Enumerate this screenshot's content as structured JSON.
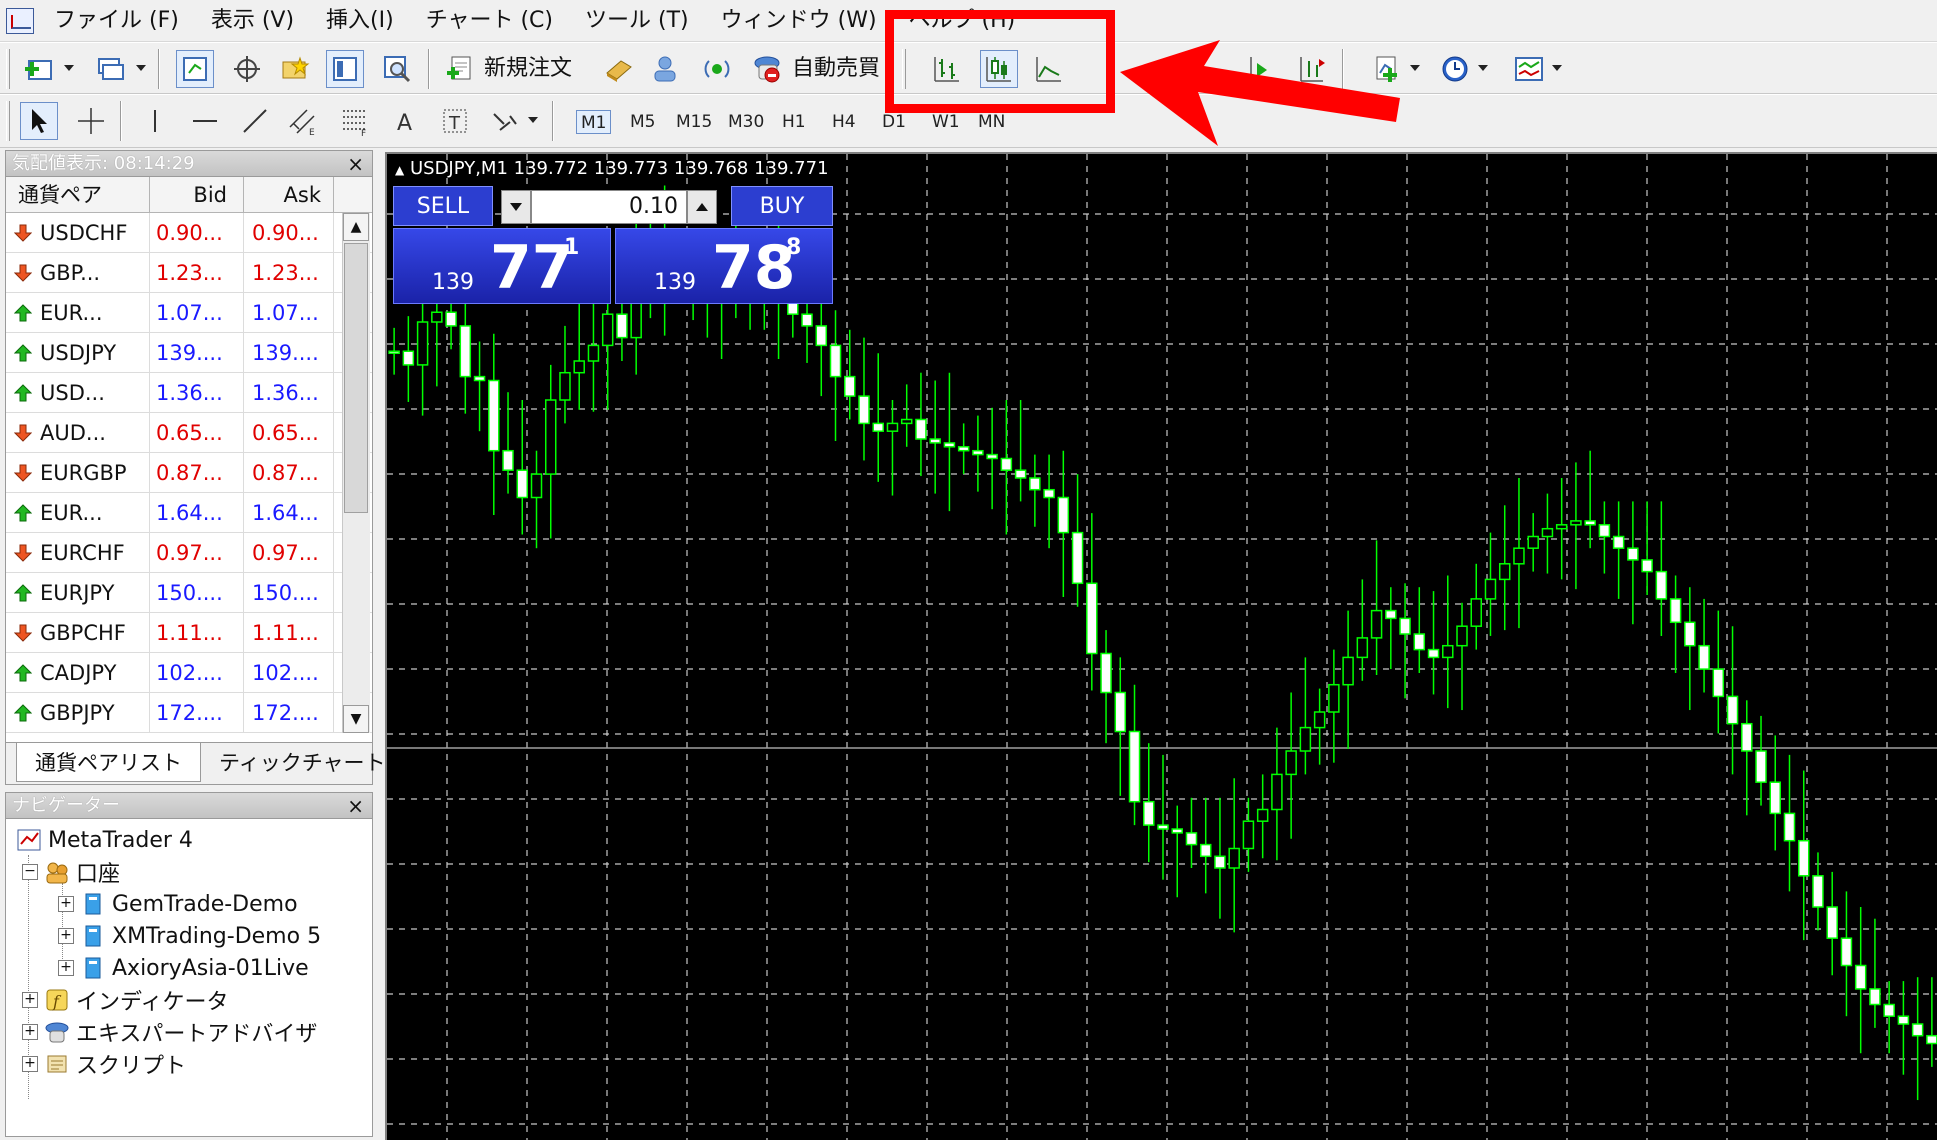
{
  "menu": [
    "ファイル (F)",
    "表示 (V)",
    "挿入(I)",
    "チャート (C)",
    "ツール (T)",
    "ウィンドウ (W)",
    "ヘルプ (H)"
  ],
  "toolbar": {
    "new_order_label": "新規注文",
    "auto_trade_label": "自動売買"
  },
  "timeframes": [
    "M1",
    "M5",
    "M15",
    "M30",
    "H1",
    "H4",
    "D1",
    "W1",
    "MN"
  ],
  "market_watch": {
    "title": "気配値表示: 08:14:29",
    "col_pair": "通貨ペア",
    "col_bid": "Bid",
    "col_ask": "Ask",
    "rows": [
      {
        "pair": "USDCHF",
        "bid": "0.90...",
        "ask": "0.90...",
        "dir": "down"
      },
      {
        "pair": "GBP...",
        "bid": "1.23...",
        "ask": "1.23...",
        "dir": "down"
      },
      {
        "pair": "EUR...",
        "bid": "1.07...",
        "ask": "1.07...",
        "dir": "up"
      },
      {
        "pair": "USDJPY",
        "bid": "139....",
        "ask": "139....",
        "dir": "up"
      },
      {
        "pair": "USD...",
        "bid": "1.36...",
        "ask": "1.36...",
        "dir": "up"
      },
      {
        "pair": "AUD...",
        "bid": "0.65...",
        "ask": "0.65...",
        "dir": "down"
      },
      {
        "pair": "EURGBP",
        "bid": "0.87...",
        "ask": "0.87...",
        "dir": "down"
      },
      {
        "pair": "EUR...",
        "bid": "1.64...",
        "ask": "1.64...",
        "dir": "up"
      },
      {
        "pair": "EURCHF",
        "bid": "0.97...",
        "ask": "0.97...",
        "dir": "down"
      },
      {
        "pair": "EURJPY",
        "bid": "150....",
        "ask": "150....",
        "dir": "up"
      },
      {
        "pair": "GBPCHF",
        "bid": "1.11...",
        "ask": "1.11...",
        "dir": "down"
      },
      {
        "pair": "CADJPY",
        "bid": "102....",
        "ask": "102....",
        "dir": "up"
      },
      {
        "pair": "GBPJPY",
        "bid": "172....",
        "ask": "172....",
        "dir": "up"
      }
    ],
    "tab_pairs": "通貨ペアリスト",
    "tab_tick": "ティックチャート"
  },
  "navigator": {
    "title": "ナビゲーター",
    "root": "MetaTrader 4",
    "accounts": "口座",
    "account_list": [
      "GemTrade-Demo",
      "XMTrading-Demo 5",
      "AxioryAsia-01Live"
    ],
    "indicators": "インディケータ",
    "experts": "エキスパートアドバイザ",
    "scripts": "スクリプト"
  },
  "chart": {
    "title": "USDJPY,M1  139.772 139.773 139.768 139.771",
    "sell_label": "SELL",
    "buy_label": "BUY",
    "lot": "0.10",
    "sell_price_small": "139",
    "sell_price_big": "77",
    "sell_price_sup": "1",
    "buy_price_small": "139",
    "buy_price_big": "78",
    "buy_price_sup": "8"
  },
  "colors": {
    "bid_up": "#1a1aff",
    "bid_down": "#e00000",
    "candle": "#00ff00",
    "highlight": "#ff0000"
  }
}
